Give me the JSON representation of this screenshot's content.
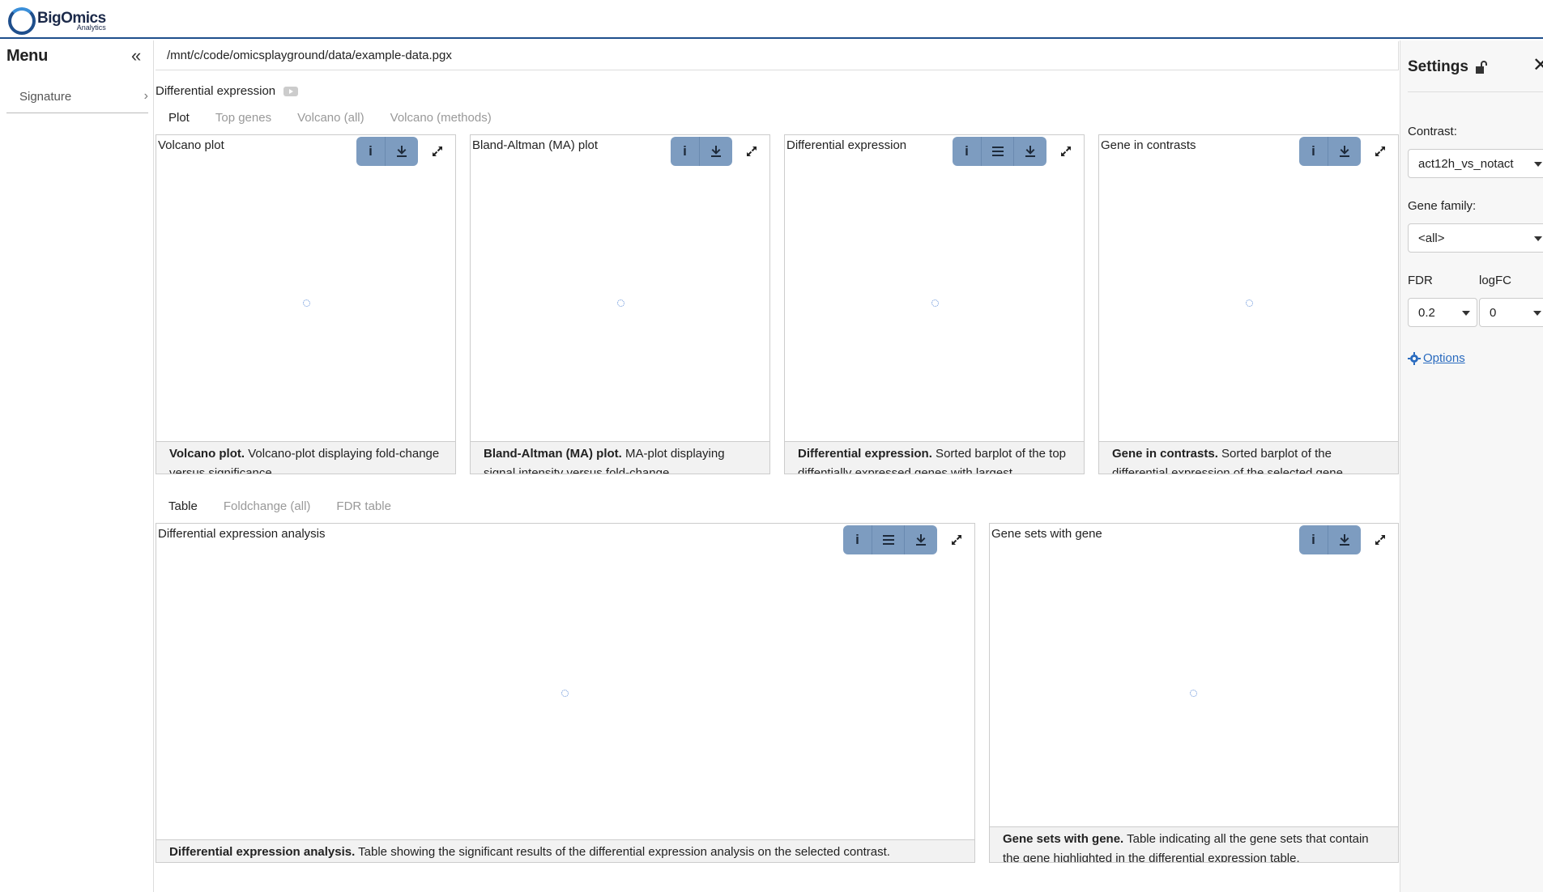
{
  "app": {
    "logo_big": "BigOmics",
    "logo_small": "Analytics"
  },
  "sidebar": {
    "title": "Menu",
    "items": [
      {
        "label": "Signature"
      }
    ]
  },
  "main": {
    "path": "/mnt/c/code/omicsplayground/data/example-data.pgx",
    "module_title": "Differential expression",
    "top_tabs": [
      "Plot",
      "Top genes",
      "Volcano (all)",
      "Volcano (methods)"
    ],
    "top_active_tab": "Plot",
    "cards_top": [
      {
        "title": "Volcano plot",
        "caption_bold": "Volcano plot.",
        "caption_text": " Volcano-plot displaying fold-change versus significance."
      },
      {
        "title": "Bland-Altman (MA) plot",
        "caption_bold": "Bland-Altman (MA) plot.",
        "caption_text": " MA-plot displaying signal intensity versus fold-change."
      },
      {
        "title": "Differential expression",
        "caption_bold": "Differential expression.",
        "caption_text": " Sorted barplot of the top diffentially expressed genes with largest"
      },
      {
        "title": "Gene in contrasts",
        "caption_bold": "Gene in contrasts.",
        "caption_text": " Sorted barplot of the differential expression of the selected gene"
      }
    ],
    "bottom_tabs": [
      "Table",
      "Foldchange (all)",
      "FDR table"
    ],
    "bottom_active_tab": "Table",
    "cards_bottom": [
      {
        "title": "Differential expression analysis",
        "caption_bold": "Differential expression analysis.",
        "caption_text": " Table showing the significant results of the differential expression analysis on the selected contrast."
      },
      {
        "title": "Gene sets with gene",
        "caption_bold": "Gene sets with gene.",
        "caption_text": " Table indicating all the gene sets that contain the gene highlighted in the differential expression table."
      }
    ]
  },
  "settings": {
    "title": "Settings",
    "contrast_label": "Contrast:",
    "contrast_value": "act12h_vs_notact",
    "gene_family_label": "Gene family:",
    "gene_family_value": "<all>",
    "fdr_label": "FDR",
    "fdr_value": "0.2",
    "logfc_label": "logFC",
    "logfc_value": "0",
    "options_label": "Options"
  },
  "colors": {
    "accent": "#1f4f8c",
    "tool_button": "#7d9cc0",
    "link": "#2a6bbf",
    "caption_bg": "#f2f2f2"
  }
}
